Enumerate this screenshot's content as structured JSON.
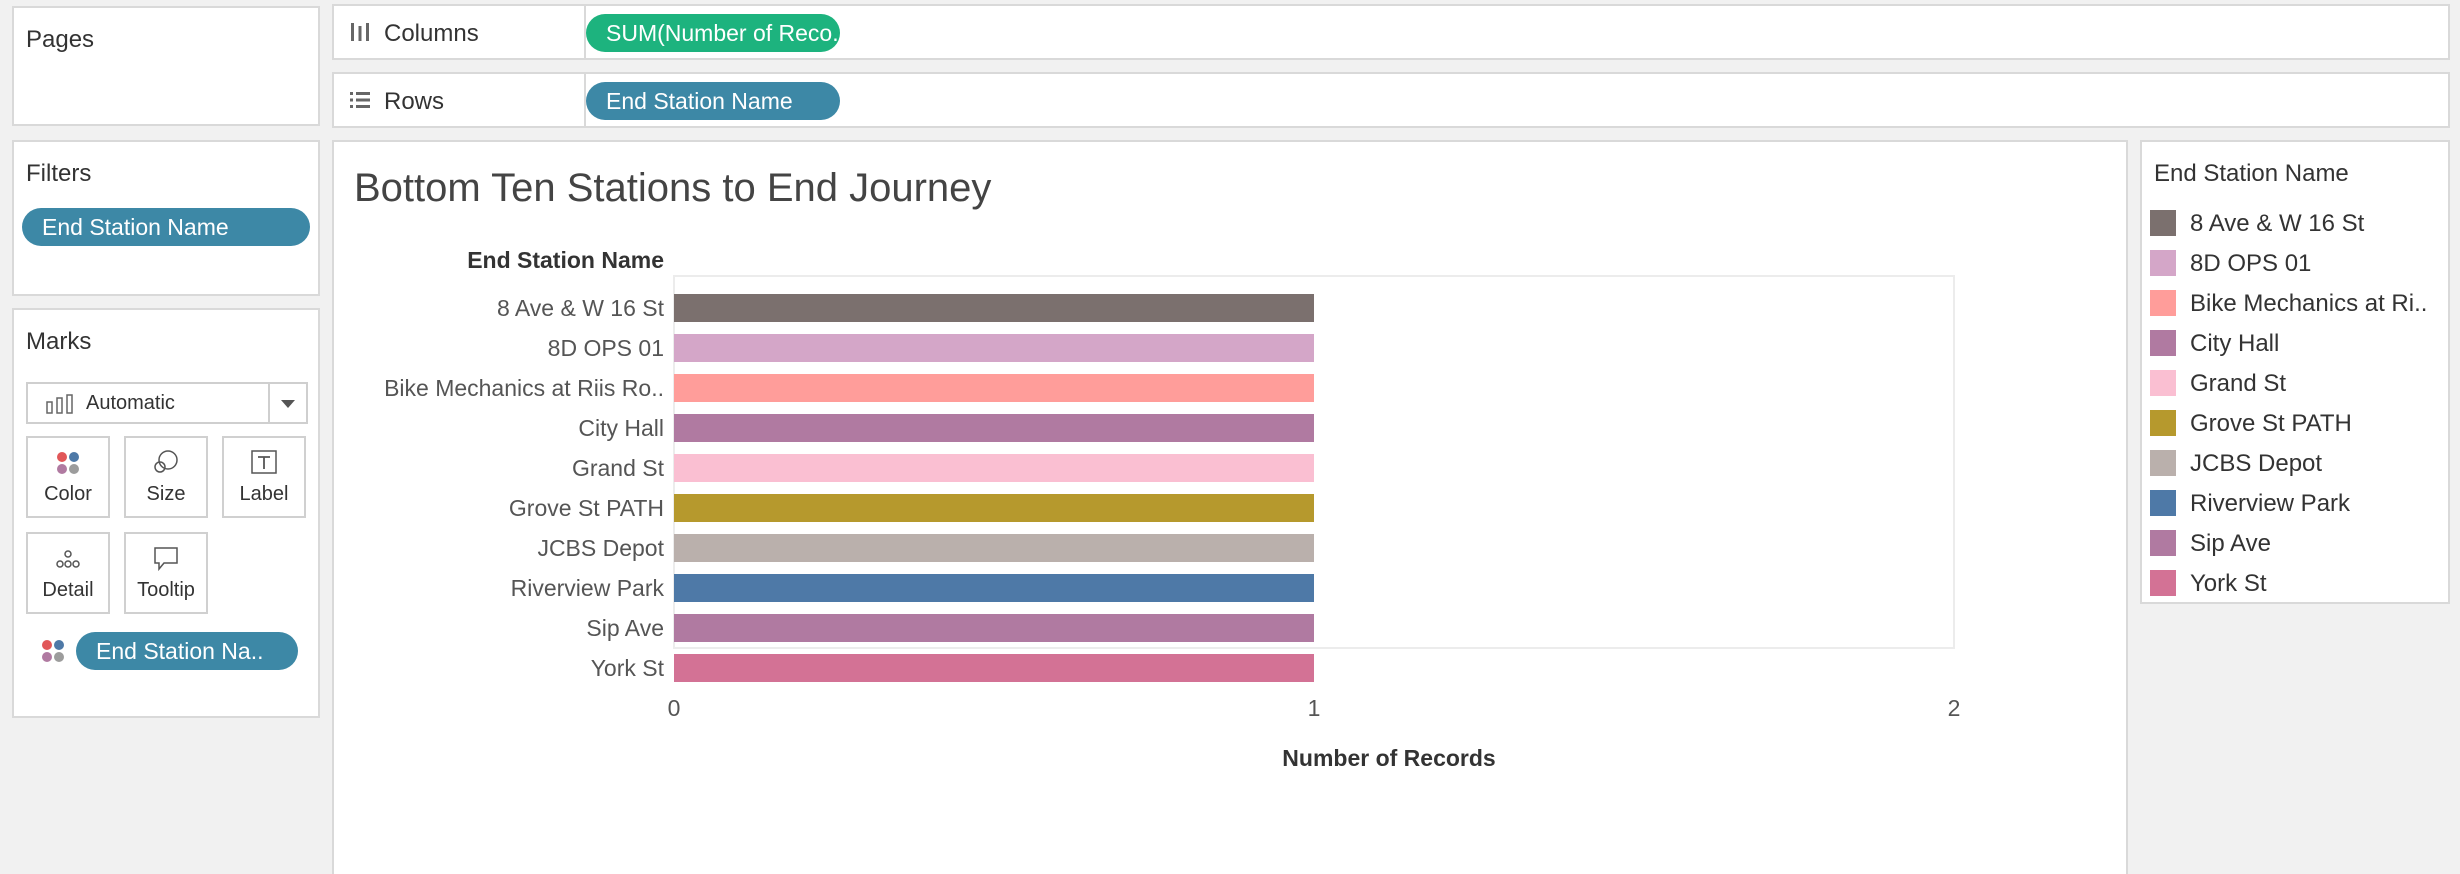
{
  "pages": {
    "title": "Pages"
  },
  "shelves": {
    "columns": {
      "label": "Columns",
      "pill": "SUM(Number of Reco.."
    },
    "rows": {
      "label": "Rows",
      "pill": "End Station Name"
    }
  },
  "filters": {
    "title": "Filters",
    "pill": "End Station Name"
  },
  "marks": {
    "title": "Marks",
    "type": "Automatic",
    "buttons": {
      "color": "Color",
      "size": "Size",
      "label": "Label",
      "detail": "Detail",
      "tooltip": "Tooltip"
    },
    "color_pill": "End Station Na.."
  },
  "legend": {
    "title": "End Station Name",
    "items": [
      {
        "name": "8 Ave & W 16 St",
        "color": "#7b706e"
      },
      {
        "name": "8D OPS 01",
        "color": "#d4a6c8"
      },
      {
        "name": "Bike Mechanics at Ri..",
        "color": "#ff9d9a"
      },
      {
        "name": "City Hall",
        "color": "#b07aa1"
      },
      {
        "name": "Grand St",
        "color": "#fabfd2"
      },
      {
        "name": "Grove St PATH",
        "color": "#b6992d"
      },
      {
        "name": "JCBS Depot",
        "color": "#bab0ac"
      },
      {
        "name": "Riverview Park",
        "color": "#4e79a7"
      },
      {
        "name": "Sip Ave",
        "color": "#b07aa1"
      },
      {
        "name": "York St",
        "color": "#d37295"
      }
    ]
  },
  "chart_data": {
    "type": "bar",
    "orientation": "horizontal",
    "title": "Bottom Ten Stations to End Journey",
    "row_header": "End Station Name",
    "xlabel": "Number of Records",
    "xlim": [
      0,
      2
    ],
    "xticks": [
      "0",
      "1",
      "2"
    ],
    "grid": false,
    "categories": [
      "8 Ave & W 16 St",
      "8D OPS 01",
      "Bike Mechanics at Riis Ro..",
      "City Hall",
      "Grand St",
      "Grove St PATH",
      "JCBS Depot",
      "Riverview Park",
      "Sip Ave",
      "York St"
    ],
    "values": [
      1,
      1,
      1,
      1,
      1,
      1,
      1,
      1,
      1,
      1
    ],
    "colors": [
      "#7b706e",
      "#d4a6c8",
      "#ff9d9a",
      "#b07aa1",
      "#fabfd2",
      "#b6992d",
      "#bab0ac",
      "#4e79a7",
      "#b07aa1",
      "#d37295"
    ]
  }
}
